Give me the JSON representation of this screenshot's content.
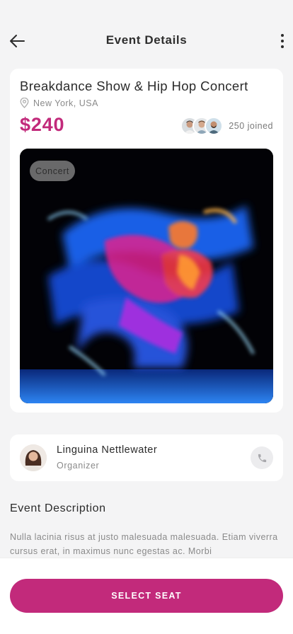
{
  "header": {
    "title": "Event Details",
    "back_icon": "arrow-left-icon",
    "more_icon": "more-vertical-icon"
  },
  "event": {
    "title": "Breakdance Show & Hip Hop Concert",
    "location": "New York, USA",
    "location_icon": "location-pin-icon",
    "price": "$240",
    "joined_text": "250 joined",
    "category": "Concert",
    "image_subject": "dancer-motion-blur-photo"
  },
  "organizer": {
    "name": "Linguina Nettlewater",
    "role": "Organizer",
    "call_icon": "phone-icon"
  },
  "description": {
    "heading": "Event Description",
    "text": "Nulla lacinia risus at justo malesuada malesuada. Etiam viverra cursus erat, in maximus nunc egestas ac. Morbi"
  },
  "cta": {
    "label": "SELECT SEAT"
  },
  "colors": {
    "accent": "#c22a7b",
    "background": "#f4f4f5",
    "card": "#ffffff",
    "muted_text": "#8a8a8a"
  }
}
